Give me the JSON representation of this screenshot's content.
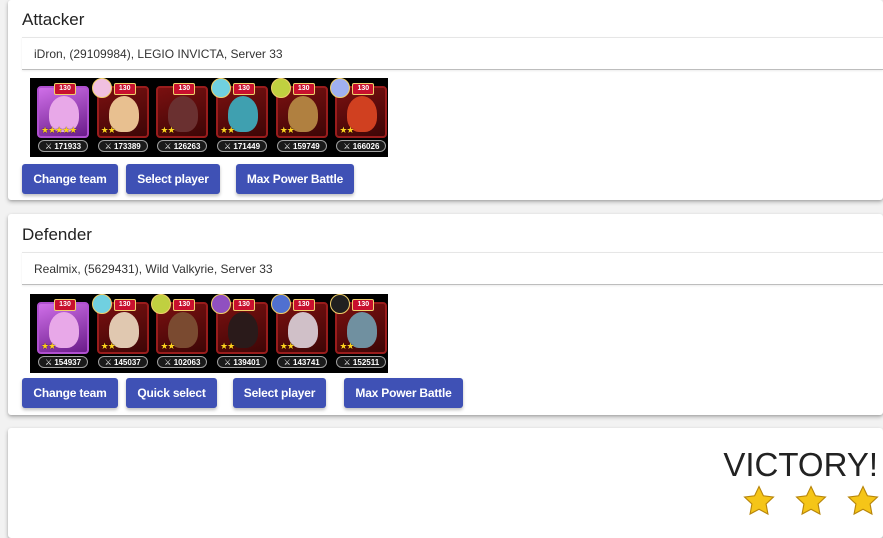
{
  "attacker": {
    "title": "Attacker",
    "player": "iDron, (29109984), LEGIO INVICTA, Server 33",
    "heroes": [
      {
        "level": "130",
        "power": "171933",
        "stars": "★★★★★",
        "tone": "purple",
        "face": "#e8a8e8",
        "pet": ""
      },
      {
        "level": "130",
        "power": "173389",
        "stars": "★★",
        "tone": "red",
        "face": "#e8c090",
        "pet": "#f0c0e0"
      },
      {
        "level": "130",
        "power": "126263",
        "stars": "★★",
        "tone": "red",
        "face": "#6a3030",
        "pet": ""
      },
      {
        "level": "130",
        "power": "171449",
        "stars": "★★",
        "tone": "red",
        "face": "#3fa0b0",
        "pet": "#70d0e0"
      },
      {
        "level": "130",
        "power": "159749",
        "stars": "★★",
        "tone": "red",
        "face": "#b08040",
        "pet": "#c0d040"
      },
      {
        "level": "130",
        "power": "166026",
        "stars": "★★",
        "tone": "red",
        "face": "#d04020",
        "pet": "#a0b0f0"
      }
    ],
    "buttons": {
      "change_team": "Change team",
      "select_player": "Select player",
      "max_power": "Max Power Battle"
    }
  },
  "defender": {
    "title": "Defender",
    "player": "Realmix, (5629431), Wild Valkyrie, Server 33",
    "heroes": [
      {
        "level": "130",
        "power": "154937",
        "stars": "★★",
        "tone": "purple",
        "face": "#e8a8e8",
        "pet": ""
      },
      {
        "level": "130",
        "power": "145037",
        "stars": "★★",
        "tone": "red",
        "face": "#e0c8b0",
        "pet": "#70d0e0"
      },
      {
        "level": "130",
        "power": "102063",
        "stars": "★★",
        "tone": "red",
        "face": "#7a4a30",
        "pet": "#c0d040"
      },
      {
        "level": "130",
        "power": "139401",
        "stars": "★★",
        "tone": "red",
        "face": "#2a1a1a",
        "pet": "#9050c0"
      },
      {
        "level": "130",
        "power": "143741",
        "stars": "★★",
        "tone": "red",
        "face": "#d0c0c8",
        "pet": "#5070d0"
      },
      {
        "level": "130",
        "power": "152511",
        "stars": "★★",
        "tone": "red",
        "face": "#7090a0",
        "pet": "#202020"
      }
    ],
    "buttons": {
      "change_team": "Change team",
      "quick_select": "Quick select",
      "select_player": "Select player",
      "max_power": "Max Power Battle"
    }
  },
  "result": {
    "label": "VICTORY!",
    "stars_earned": 3,
    "star_color": "#f5c518"
  },
  "colors": {
    "button": "#3f51b5",
    "background": "#f2f2f2"
  }
}
